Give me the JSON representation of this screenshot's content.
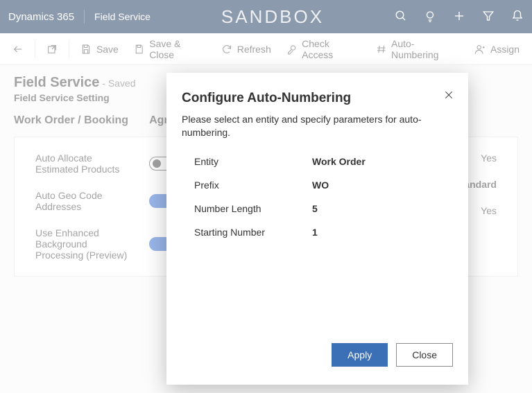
{
  "topbar": {
    "brand": "Dynamics 365",
    "subbrand": "Field Service",
    "env": "SANDBOX"
  },
  "cmd": {
    "save": "Save",
    "save_close": "Save & Close",
    "refresh": "Refresh",
    "check_access": "Check Access",
    "auto_numbering": "Auto-Numbering",
    "assign": "Assign"
  },
  "record": {
    "title": "Field Service",
    "status": "- Saved",
    "entity": "Field Service Setting"
  },
  "tabs": {
    "t0": "Work Order / Booking",
    "t1": "Agre"
  },
  "form": {
    "left": {
      "r0": {
        "label": "Auto Allocate Estimated Products"
      },
      "r1": {
        "label": "Auto Geo Code Addresses"
      },
      "r2": {
        "label": "Use Enhanced Background Processing (Preview)"
      }
    },
    "right": {
      "r0": {
        "value": "Yes"
      },
      "r1": {
        "value": "/Standard"
      },
      "r2": {
        "value": "Yes"
      }
    }
  },
  "dialog": {
    "title": "Configure Auto-Numbering",
    "desc": "Please select an entity and specify parameters for auto-numbering.",
    "fields": {
      "entity": {
        "label": "Entity",
        "value": "Work Order"
      },
      "prefix": {
        "label": "Prefix",
        "value": "WO"
      },
      "length": {
        "label": "Number Length",
        "value": "5"
      },
      "start": {
        "label": "Starting Number",
        "value": "1"
      }
    },
    "apply": "Apply",
    "close": "Close"
  }
}
